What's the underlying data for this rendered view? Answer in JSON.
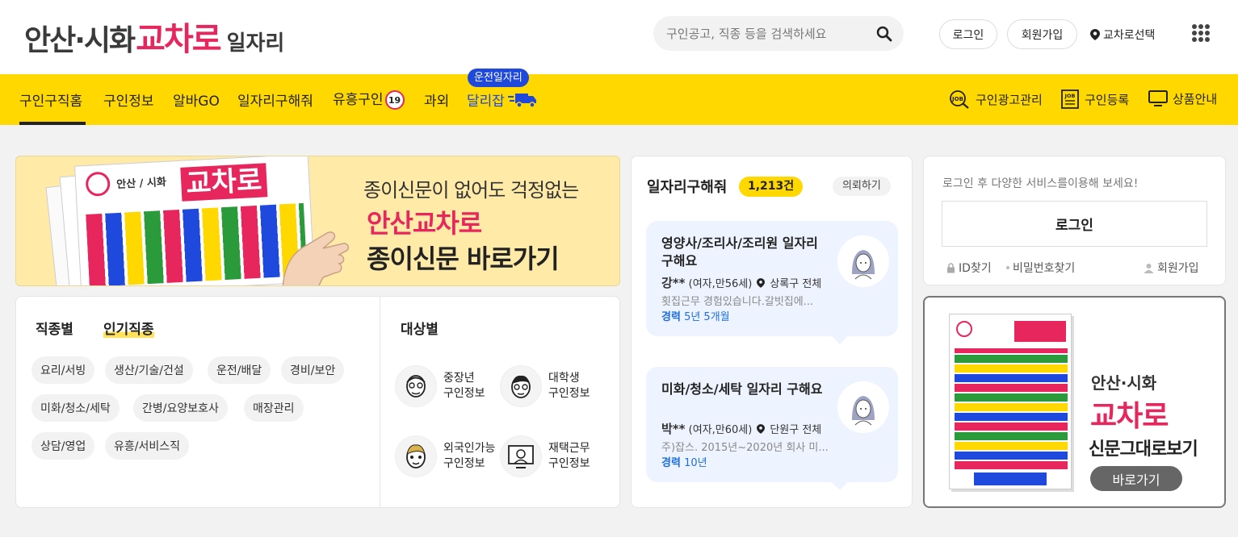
{
  "header": {
    "logo": {
      "region": "안산·시화",
      "brand": "교차로",
      "suffix": "일자리"
    },
    "search_placeholder": "구인공고, 직종 등을 검색하세요",
    "login": "로그인",
    "signup": "회원가입",
    "region_select": "교차로선택"
  },
  "nav": {
    "items": [
      "구인구직홈",
      "구인정보",
      "알바GO",
      "일자리구해줘",
      "유흥구인",
      "과외",
      "달리잡"
    ],
    "adult_badge": "19",
    "drive_tag": "운전일자리",
    "right": [
      "구인광고관리",
      "구인등록",
      "상품안내"
    ]
  },
  "banner": {
    "line1": "종이신문이 없어도 걱정없는",
    "line2": "안산교차로",
    "line3": "종이신문 바로가기",
    "np_region": "안산 / 시화",
    "np_brand": "교차로"
  },
  "categories": {
    "tab_job": "직종별",
    "tab_popular": "인기직종",
    "tab_target": "대상별",
    "chips": [
      "요리/서빙",
      "생산/기술/건설",
      "운전/배달",
      "경비/보안",
      "미화/청소/세탁",
      "간병/요양보호사",
      "매장관리",
      "상담/영업",
      "유흥/서비스직"
    ],
    "targets": [
      {
        "name": "중장년",
        "sub": "구인정보"
      },
      {
        "name": "대학생",
        "sub": "구인정보"
      },
      {
        "name": "외국인가능",
        "sub": "구인정보"
      },
      {
        "name": "재택근무",
        "sub": "구인정보"
      }
    ]
  },
  "seeker": {
    "title": "일자리구해줘",
    "count": "1,213건",
    "request": "의뢰하기",
    "resumes": [
      {
        "title": "영양사/조리사/조리원 일자리 구해요",
        "name": "강**",
        "info": "(여자,만56세)",
        "area": "상록구 전체",
        "desc": "횟집근무 경험있습니다.갈빗집에...",
        "exp_label": "경력",
        "exp": "5년 5개월"
      },
      {
        "title": "미화/청소/세탁 일자리 구해요",
        "name": "박**",
        "info": "(여자,만60세)",
        "area": "단원구 전체",
        "desc": "주)잡스. 2015년~2020년 회사 미...",
        "exp_label": "경력",
        "exp": "10년"
      }
    ]
  },
  "login_box": {
    "message": "로그인 후 다양한 서비스를이용해 보세요!",
    "button": "로그인",
    "find_id": "ID찾기",
    "find_pw": "비밀번호찾기",
    "join": "회원가입"
  },
  "paper_ad": {
    "line1": "안산·시화",
    "line2": "교차로",
    "line3": "신문그대로보기",
    "button": "바로가기"
  },
  "colors": {
    "accent": "#ffd800",
    "brand": "#e8265e",
    "link": "#1f6fe0"
  }
}
